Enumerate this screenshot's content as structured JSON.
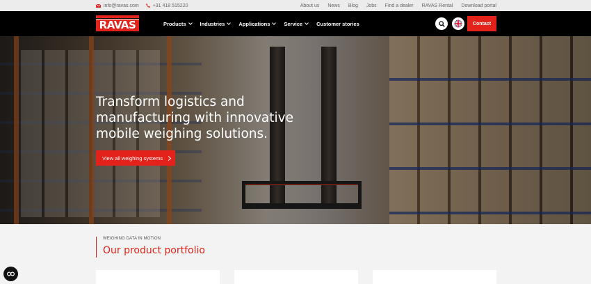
{
  "topbar": {
    "email": "info@ravas.com",
    "phone": "+31 418 515220",
    "links": [
      "About us",
      "News",
      "Blog",
      "Jobs",
      "Find a dealer",
      "RAVAS Rental",
      "Download portal"
    ]
  },
  "nav": {
    "logo_text": "RAVAS",
    "items": [
      {
        "label": "Products",
        "has_dropdown": true
      },
      {
        "label": "Industries",
        "has_dropdown": true
      },
      {
        "label": "Applications",
        "has_dropdown": true
      },
      {
        "label": "Service",
        "has_dropdown": true
      },
      {
        "label": "Customer stories",
        "has_dropdown": false
      }
    ],
    "contact_label": "Contact",
    "icons": {
      "search": "search-icon",
      "language": "uk-flag-icon"
    }
  },
  "hero": {
    "heading": "Transform logistics and manufacturing with innovative mobile weighing solutions.",
    "cta_label": "View all weighing systems"
  },
  "portfolio": {
    "kicker": "WEIGHING DATA IN MOTION",
    "title": "Our product portfolio"
  },
  "colors": {
    "accent": "#e3221b",
    "nav_bg": "#000000",
    "topbar_bg": "#ececec"
  }
}
